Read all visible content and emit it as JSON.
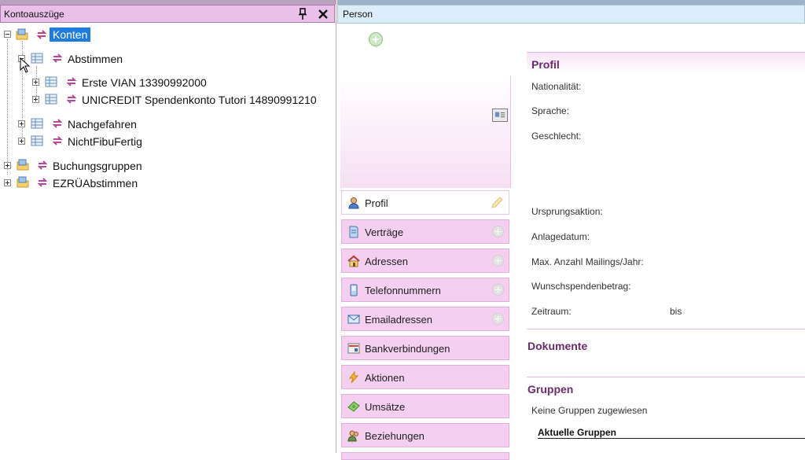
{
  "left_panel": {
    "title": "Kontoauszüge",
    "tree": {
      "root": "Konten",
      "abstimmen": "Abstimmen",
      "erste": "Erste VIAN 13390992000",
      "unicredit": "UNICREDIT Spendenkonto Tutori 14890991210",
      "nachgefahren": "Nachgefahren",
      "nichtfibu": "NichtFibuFertig",
      "buchungsgruppen": "Buchungsgruppen",
      "ezru": "EZRÜAbstimmen"
    }
  },
  "right_panel": {
    "title": "Person",
    "nav": [
      {
        "label": "Profil"
      },
      {
        "label": "Verträge"
      },
      {
        "label": "Adressen"
      },
      {
        "label": "Telefonnummern"
      },
      {
        "label": "Emailadressen"
      },
      {
        "label": "Bankverbindungen"
      },
      {
        "label": "Aktionen"
      },
      {
        "label": "Umsätze"
      },
      {
        "label": "Beziehungen"
      }
    ],
    "profil": {
      "heading": "Profil",
      "nationalitaet": "Nationalität:",
      "sprache": "Sprache:",
      "geschlecht": "Geschlecht:",
      "ursprungsaktion": "Ursprungsaktion:",
      "anlagedatum": "Anlagedatum:",
      "max_mailings": "Max. Anzahl Mailings/Jahr:",
      "wunschspende": "Wunschspendenbetrag:",
      "zeitraum": "Zeitraum:",
      "bis": "bis"
    },
    "dokumente": {
      "heading": "Dokumente"
    },
    "gruppen": {
      "heading": "Gruppen",
      "none": "Keine Gruppen zugewiesen",
      "aktuelle": "Aktuelle Gruppen"
    }
  },
  "colors": {
    "left_title_bg": "#eabfe8",
    "right_title_bg": "#dcecf8",
    "nav_bg": "#f4cff0",
    "section_heading": "#6a2c6e",
    "selection": "#1e7be0"
  }
}
